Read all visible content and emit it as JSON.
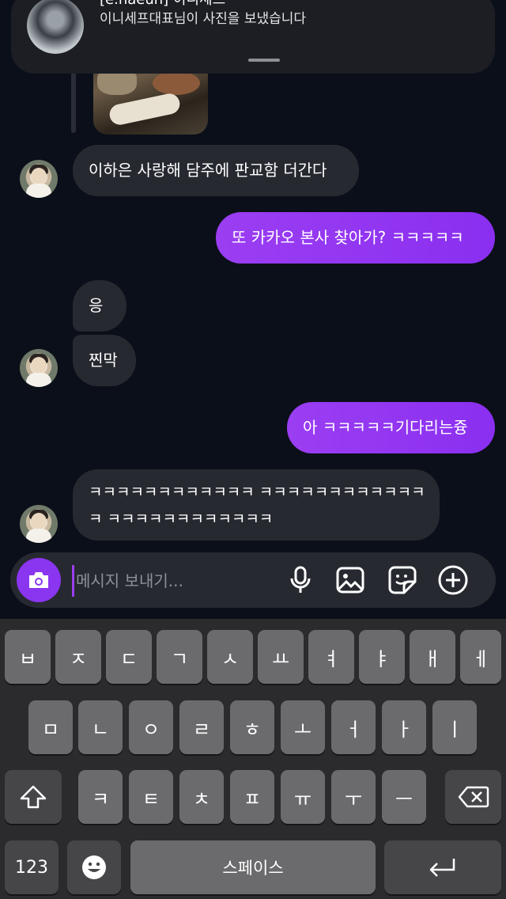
{
  "notification": {
    "title": "[e.haeun] 이니세프",
    "body": "이니세프대표님이 사진을 보냈습니다"
  },
  "messages": [
    {
      "side": "in",
      "text": "이하은 사랑해 담주에 판교함 더간다"
    },
    {
      "side": "out",
      "text": "또 카카오 본사 찾아가? ㅋㅋㅋㅋㅋ"
    },
    {
      "side": "in",
      "text": "응"
    },
    {
      "side": "in",
      "text": "찐막"
    },
    {
      "side": "out",
      "text": "아 ㅋㅋㅋㅋㅋ기다리는즁"
    },
    {
      "side": "in",
      "line1": "ㅋㅋㅋㅋㅋㅋㅋㅋㅋㅋㅋㅋ ㅋㅋㅋㅋㅋㅋㅋㅋㅋㅋㅋㅋ",
      "line2": "ㅋ ㅋㅋㅋㅋㅋㅋㅋㅋㅋㅋㅋㅋ"
    }
  ],
  "composer": {
    "placeholder": "메시지 보내기...",
    "icons": [
      "camera-icon",
      "microphone-icon",
      "gallery-icon",
      "sticker-icon",
      "add-icon"
    ]
  },
  "keyboard": {
    "row1": [
      "ㅂ",
      "ㅈ",
      "ㄷ",
      "ㄱ",
      "ㅅ",
      "ㅛ",
      "ㅕ",
      "ㅑ",
      "ㅐ",
      "ㅔ"
    ],
    "row2": [
      "ㅁ",
      "ㄴ",
      "ㅇ",
      "ㄹ",
      "ㅎ",
      "ㅗ",
      "ㅓ",
      "ㅏ",
      "ㅣ"
    ],
    "row3": [
      "ㅋ",
      "ㅌ",
      "ㅊ",
      "ㅍ",
      "ㅠ",
      "ㅜ",
      "ㅡ"
    ],
    "numbers_label": "123",
    "space_label": "스페이스",
    "icons": [
      "shift-icon",
      "backspace-icon",
      "emoji-icon",
      "return-icon"
    ]
  },
  "colors": {
    "background": "#0b0f19",
    "incoming_bubble": "#262930",
    "outgoing_bubble": "#8a2ff0",
    "accent": "#8a35ef"
  }
}
